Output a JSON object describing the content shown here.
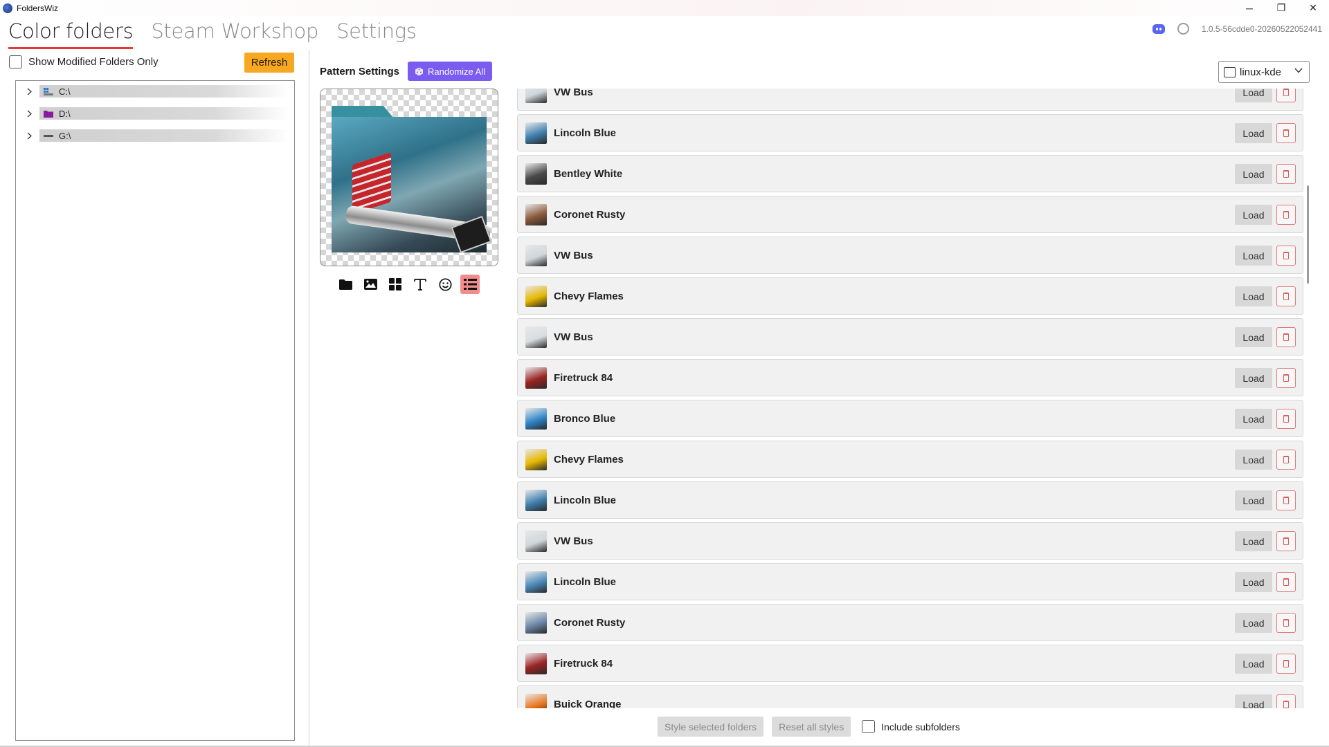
{
  "window": {
    "title": "FoldersWiz",
    "controls": {
      "minimize": "─",
      "restore": "❐",
      "close": "✕"
    }
  },
  "nav": {
    "tabs": [
      {
        "label": "Color folders",
        "active": true
      },
      {
        "label": "Steam Workshop",
        "active": false
      },
      {
        "label": "Settings",
        "active": false
      }
    ]
  },
  "header": {
    "version": "1.0.5-56cdde0-20260522052441",
    "icons": [
      "discord-icon",
      "globe-icon"
    ]
  },
  "left": {
    "show_modified_label": "Show Modified Folders Only",
    "show_modified_checked": false,
    "refresh_label": "Refresh",
    "drives": [
      {
        "name": "C:\\",
        "icon": "windows-drive-icon",
        "color": "#1e6fd9"
      },
      {
        "name": "D:\\",
        "icon": "folder-icon",
        "color": "#8a1aa0"
      },
      {
        "name": "G:\\",
        "icon": "drive-icon",
        "color": "#555555"
      }
    ]
  },
  "pattern": {
    "title": "Pattern Settings",
    "randomize_label": "Randomize All",
    "tools": [
      {
        "name": "folder-tool-icon",
        "active": false
      },
      {
        "name": "image-tool-icon",
        "active": false
      },
      {
        "name": "grid-tool-icon",
        "active": false
      },
      {
        "name": "text-tool-icon",
        "active": false
      },
      {
        "name": "emoji-tool-icon",
        "active": false
      },
      {
        "name": "list-tool-icon",
        "active": true
      }
    ]
  },
  "theme": {
    "selected": "linux-kde"
  },
  "presets": {
    "load_label": "Load",
    "items": [
      {
        "name": "VW Bus",
        "thumb": "#cfd6db"
      },
      {
        "name": "Lincoln Blue",
        "thumb": "#3f7fae"
      },
      {
        "name": "Bentley White",
        "thumb": "#4b4b4b"
      },
      {
        "name": "Coronet Rusty",
        "thumb": "#8a5a3c"
      },
      {
        "name": "VW Bus",
        "thumb": "#cfd6db"
      },
      {
        "name": "Chevy Flames",
        "thumb": "#e6b800"
      },
      {
        "name": "VW Bus",
        "thumb": "#d8dde0"
      },
      {
        "name": "Firetruck 84",
        "thumb": "#9b2323"
      },
      {
        "name": "Bronco Blue",
        "thumb": "#2f86c9"
      },
      {
        "name": "Chevy Flames",
        "thumb": "#e6b800"
      },
      {
        "name": "Lincoln Blue",
        "thumb": "#3f7fae"
      },
      {
        "name": "VW Bus",
        "thumb": "#cfd6db"
      },
      {
        "name": "Lincoln Blue",
        "thumb": "#4b8ab9"
      },
      {
        "name": "Coronet Rusty",
        "thumb": "#6b86a8"
      },
      {
        "name": "Firetruck 84",
        "thumb": "#9b2323"
      },
      {
        "name": "Buick Orange",
        "thumb": "#e8741a"
      }
    ]
  },
  "bottom": {
    "style_selected_label": "Style selected folders",
    "reset_all_label": "Reset all styles",
    "include_subfolders_label": "Include subfolders",
    "include_subfolders_checked": false
  },
  "colors": {
    "accent_red": "#e53935",
    "refresh_orange": "#f6a822",
    "randomize_purple": "#7a5cf0",
    "active_tool_pink": "#f28c8c"
  }
}
